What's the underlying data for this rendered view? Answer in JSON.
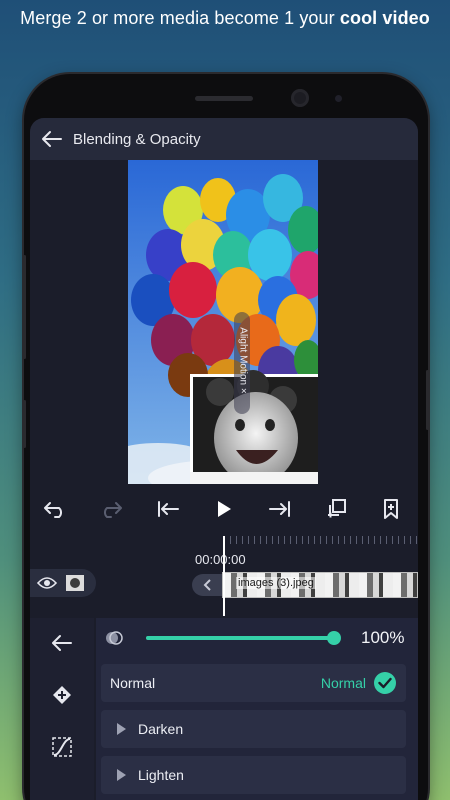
{
  "headline": {
    "prefix": "Merge 2 or more media become 1 your ",
    "emphasis": "cool video"
  },
  "appbar": {
    "title": "Blending & Opacity",
    "back_icon": "arrow-left-icon"
  },
  "preview": {
    "watermark": "Alight Motion ×"
  },
  "transport": {
    "buttons": [
      "undo-icon",
      "redo-icon",
      "skip-to-start-icon",
      "play-icon",
      "skip-to-end-icon",
      "duplicate-icon",
      "bookmark-add-icon"
    ]
  },
  "timeline": {
    "timecode": "00:00:00",
    "clip_label": "images (3).jpeg"
  },
  "tools": [
    "arrow-left-icon",
    "keyframe-add-icon",
    "curve-icon"
  ],
  "opacity": {
    "value_label": "100%",
    "value": 1.0
  },
  "blend": {
    "current_row_label": "Normal",
    "selected_value": "Normal",
    "groups": [
      "Darken",
      "Lighten"
    ]
  },
  "colors": {
    "accent": "#35d0a8",
    "background": "#1b1d2a",
    "panel": "#22253a"
  }
}
